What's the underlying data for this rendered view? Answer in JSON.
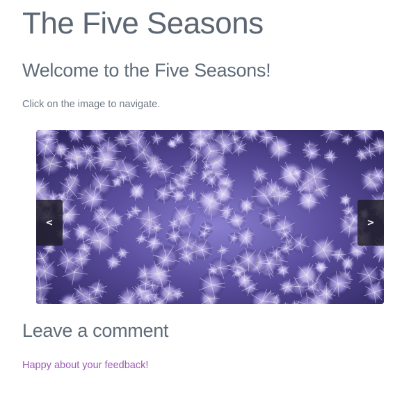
{
  "site": {
    "title": "The Five Seasons"
  },
  "main": {
    "welcome_heading": "Welcome to the Five Seasons!",
    "instructions": "Click on the image to navigate."
  },
  "slider": {
    "image_description": "snowy-forest-aerial",
    "prev_label": "<",
    "next_label": ">"
  },
  "comments": {
    "heading": "Leave a comment",
    "feedback_link": "Happy about your feedback!"
  },
  "colors": {
    "title_text": "#5b6672",
    "link": "#9b59b6",
    "slide_tint": "#6b5cb0",
    "nav_button_bg": "#1e1c26"
  }
}
